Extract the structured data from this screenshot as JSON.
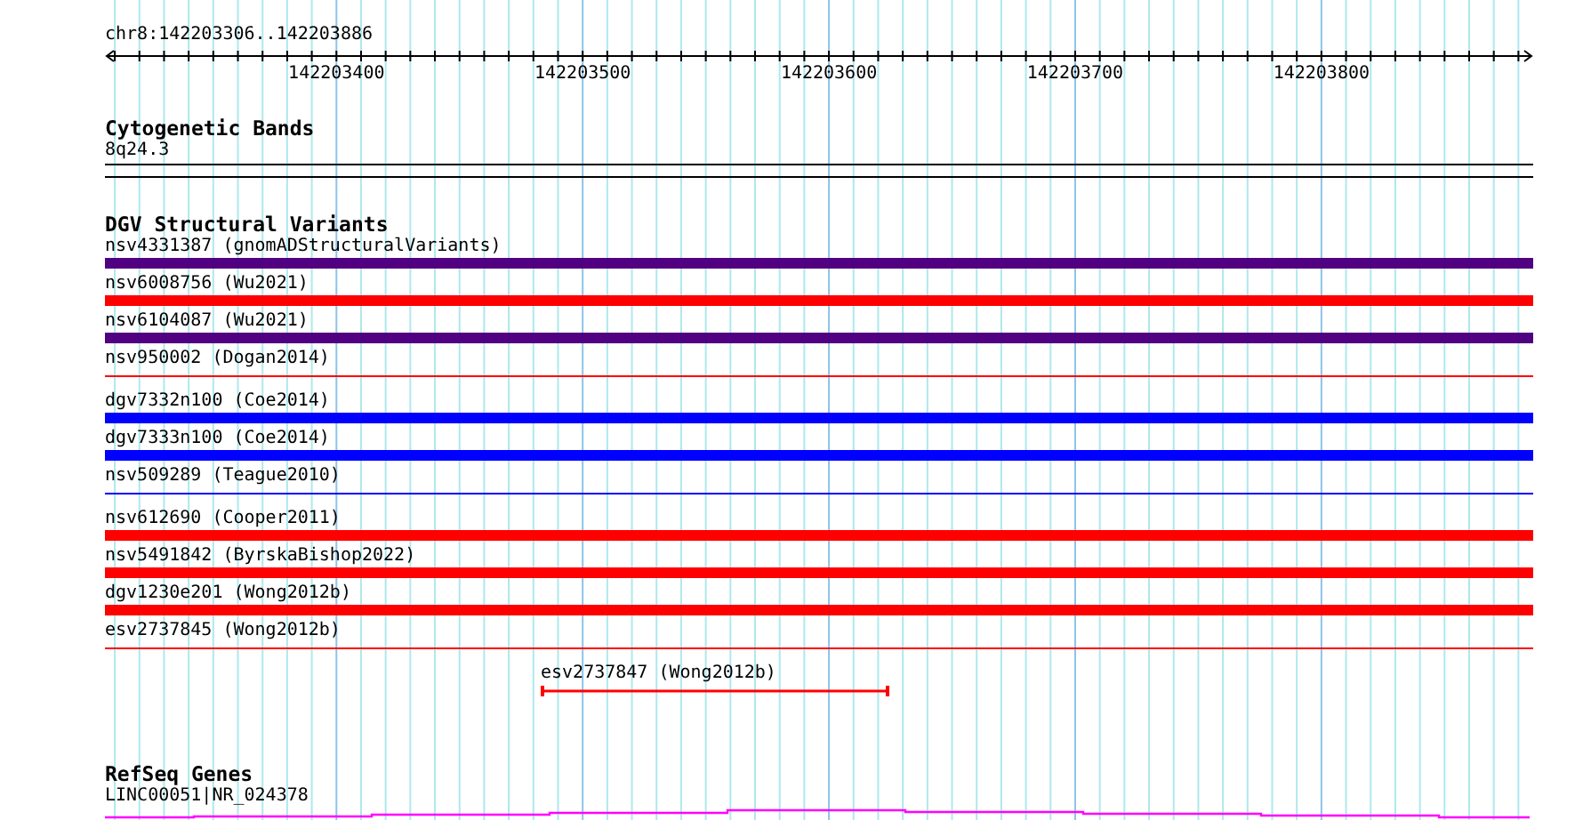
{
  "ruler": {
    "position": "chr8:142203306..142203886",
    "tick_labels": [
      "142203400",
      "142203500",
      "142203600",
      "142203700",
      "142203800"
    ]
  },
  "tracks": [
    {
      "kind": "cytoband",
      "title": "Cytogenetic Bands",
      "band": "8q24.3"
    },
    {
      "kind": "variants",
      "title": "DGV Structural Variants",
      "items": [
        {
          "kind": "thick",
          "label": "nsv4331387 (gnomADStructuralVariants)",
          "color": "#500080"
        },
        {
          "kind": "thick",
          "label": "nsv6008756 (Wu2021)",
          "color": "#ff0000"
        },
        {
          "kind": "thick",
          "label": "nsv6104087 (Wu2021)",
          "color": "#500080"
        },
        {
          "kind": "thin",
          "label": "nsv950002 (Dogan2014)",
          "color": "#ff0000"
        },
        {
          "kind": "thick",
          "label": "dgv7332n100 (Coe2014)",
          "color": "#0000ff"
        },
        {
          "kind": "thick",
          "label": "dgv7333n100 (Coe2014)",
          "color": "#0000ff"
        },
        {
          "kind": "thin",
          "label": "nsv509289 (Teague2010)",
          "color": "#0000ff"
        },
        {
          "kind": "thick",
          "label": "nsv612690 (Cooper2011)",
          "color": "#ff0000"
        },
        {
          "kind": "thick",
          "label": "nsv5491842 (ByrskaBishop2022)",
          "color": "#ff0000"
        },
        {
          "kind": "thick",
          "label": "dgv1230e201 (Wong2012b)",
          "color": "#ff0000"
        },
        {
          "kind": "thin",
          "label": "esv2737845 (Wong2012b)",
          "color": "#ff0000"
        },
        {
          "kind": "partial",
          "label": "esv2737847 (Wong2012b)",
          "color": "#ff0000"
        }
      ]
    },
    {
      "kind": "gene",
      "title": "RefSeq Genes",
      "gene": "LINC00051|NR_024378"
    }
  ]
}
